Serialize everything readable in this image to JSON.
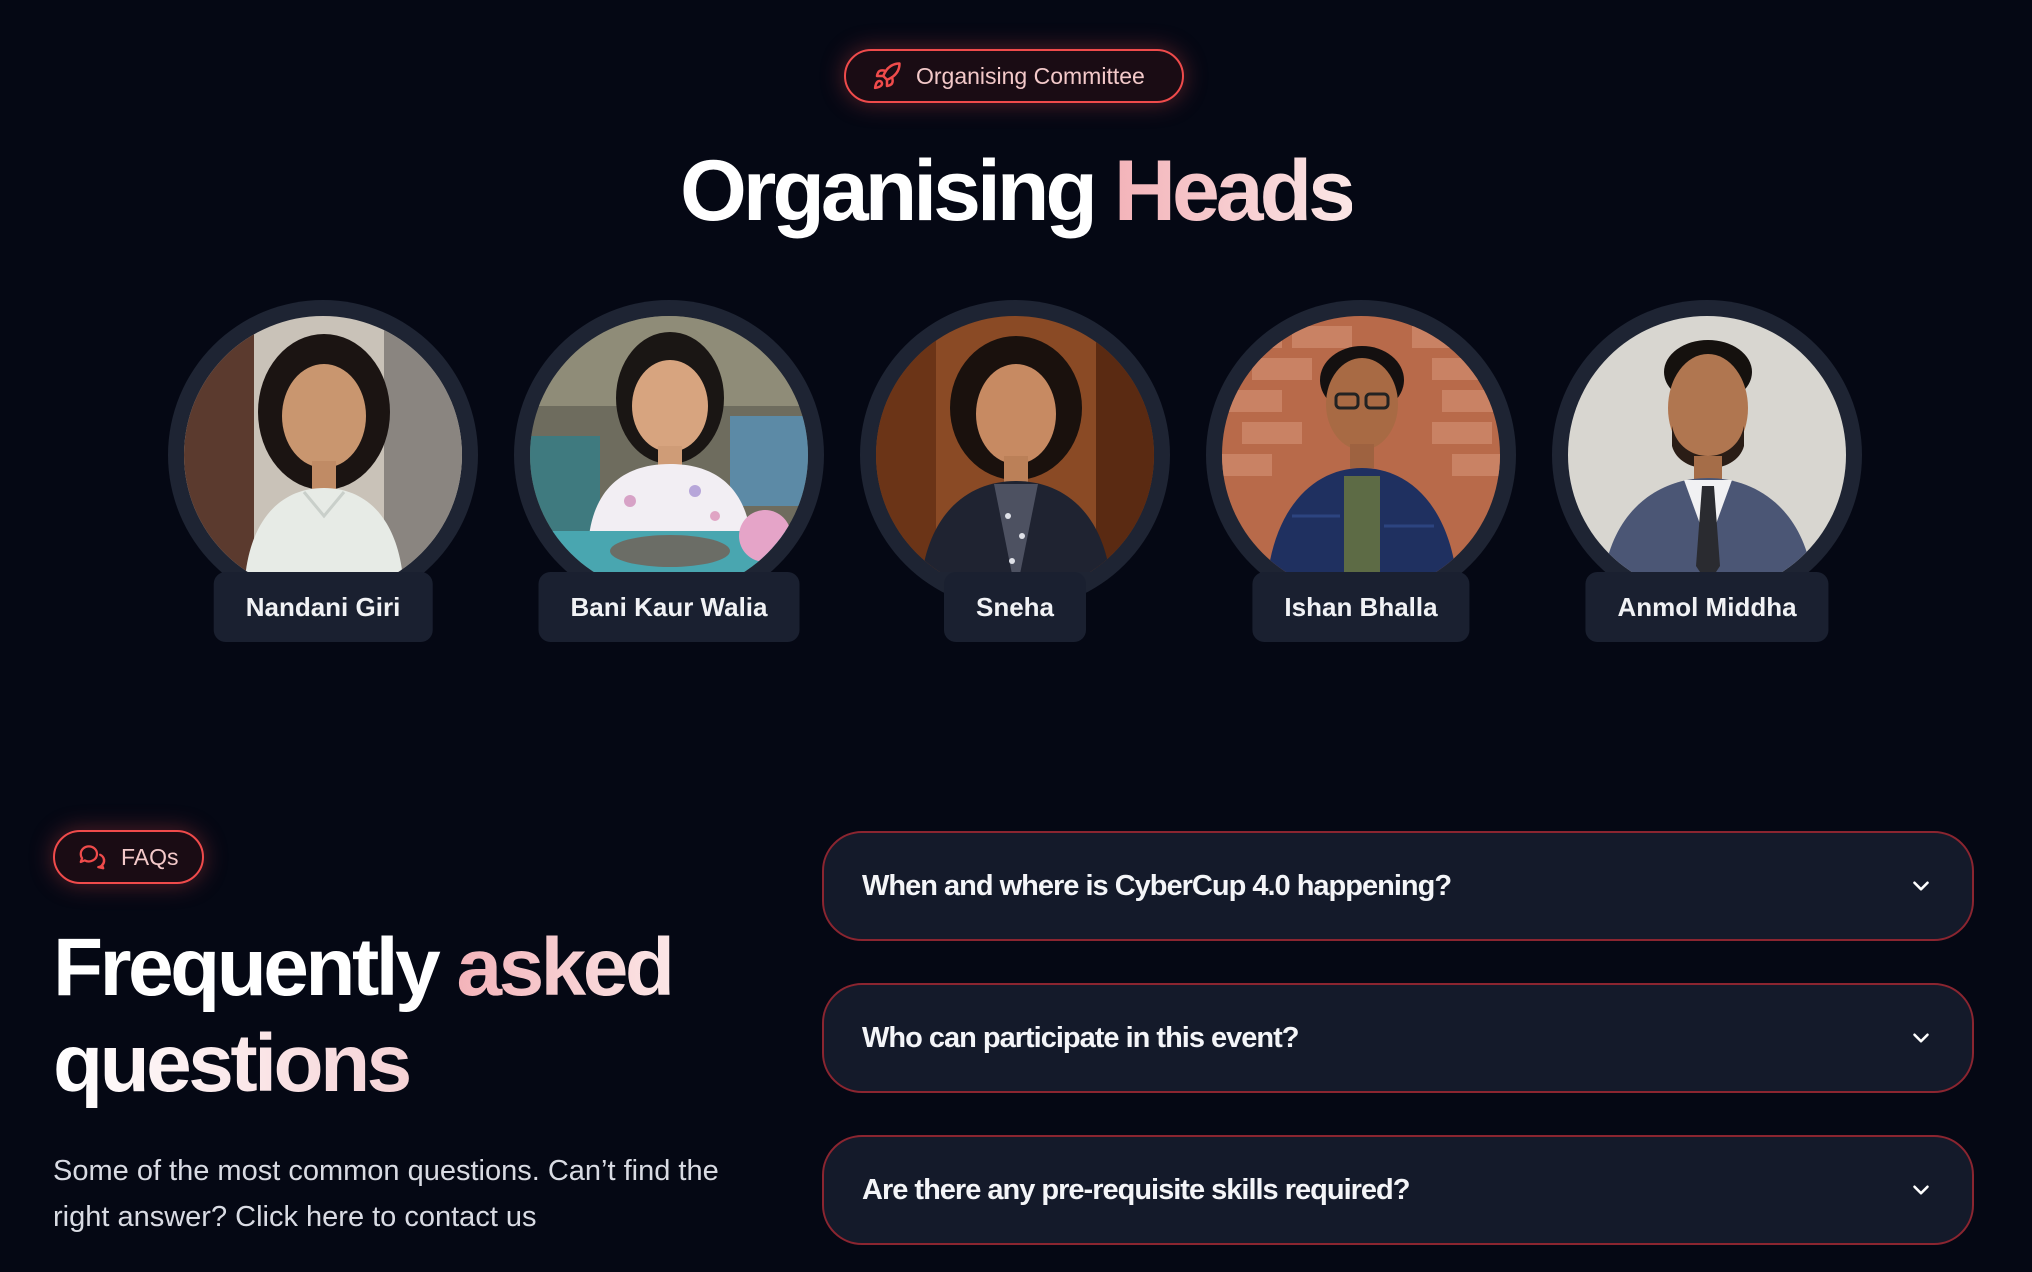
{
  "committee_badge": {
    "label": "Organising Committee",
    "icon": "rocket-icon"
  },
  "heads_heading": {
    "part1": "Organising",
    "part2": "Heads"
  },
  "people": [
    {
      "name": "Nandani Giri"
    },
    {
      "name": "Bani Kaur Walia"
    },
    {
      "name": "Sneha"
    },
    {
      "name": "Ishan Bhalla"
    },
    {
      "name": "Anmol Middha"
    }
  ],
  "faq": {
    "badge": {
      "label": "FAQs",
      "icon": "chat-bubbles-icon"
    },
    "title": {
      "part1": "Frequently",
      "part2": "asked",
      "part3": "questions"
    },
    "subtitle": "Some of the most common questions. Can’t find the right answer? Click here to contact us",
    "questions": [
      {
        "text": "When and where is CyberCup 4.0 happening?",
        "icon": "chevron-down-icon"
      },
      {
        "text": "Who can participate in this event?",
        "icon": "chevron-down-icon"
      },
      {
        "text": "Are there any pre-requisite skills required?",
        "icon": "chevron-down-icon"
      }
    ]
  },
  "colors": {
    "background": "#050814",
    "accent_red": "#ef4b4b",
    "accent_pink": "#f3b3b9",
    "card": "#141a2a"
  }
}
